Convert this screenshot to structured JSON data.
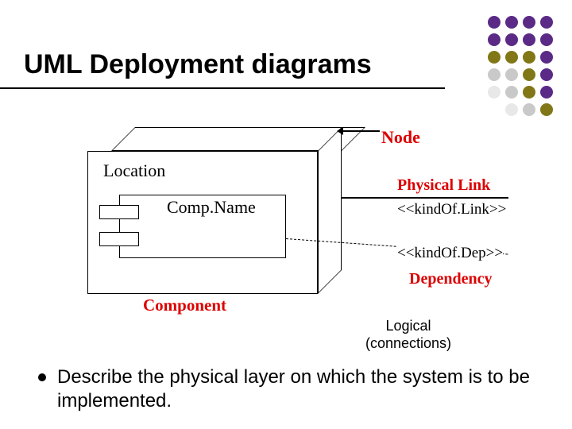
{
  "title": "UML Deployment diagrams",
  "labels": {
    "node": "Node",
    "location": "Location",
    "comp_name": "Comp.Name",
    "component": "Component",
    "physical_link": "Physical Link",
    "kind_of_link": "<<kindOf.Link>>",
    "kind_of_dep": "<<kindOf.Dep>>",
    "dependency": "Dependency"
  },
  "caption": {
    "line1": "Logical",
    "line2": "(connections)"
  },
  "bullet": {
    "text_1": "Describe the ",
    "text_strong": "physical layer",
    "text_2": " on which the system is to be implemented."
  },
  "dots": [
    "#5b2a86",
    "#5b2a86",
    "#5b2a86",
    "#5b2a86",
    "#5b2a86",
    "#5b2a86",
    "#5b2a86",
    "#5b2a86",
    "#827717",
    "#827717",
    "#827717",
    "#5b2a86",
    "#c9c9c9",
    "#c9c9c9",
    "#827717",
    "#5b2a86",
    "#e8e8e8",
    "#c9c9c9",
    "#827717",
    "#5b2a86",
    "#ffffff",
    "#e8e8e8",
    "#c9c9c9",
    "#827717"
  ]
}
